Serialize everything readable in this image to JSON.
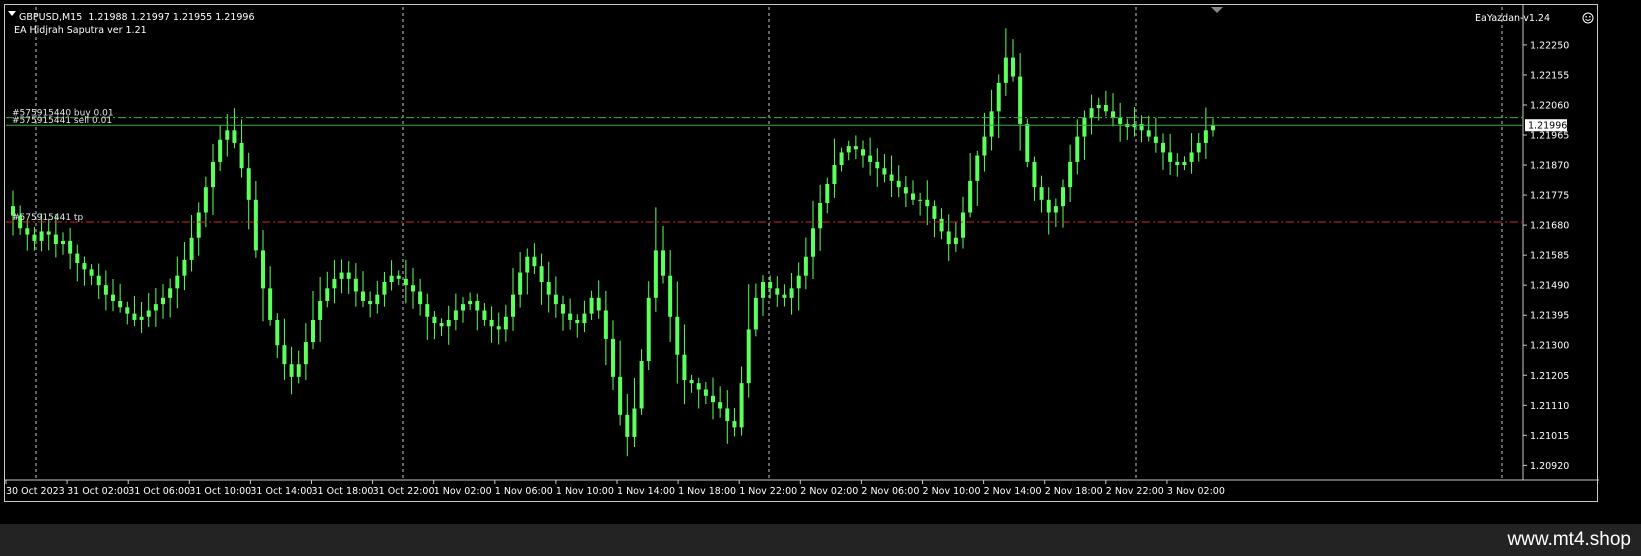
{
  "header": {
    "symbol_label": "GBPUSD,M15",
    "ohlc_text": "1.21988 1.21997 1.21955 1.21996",
    "ea_name": "EA Hidjrah Saputra ver 1.21",
    "ea_right_label": "EaYazdan-v1.24"
  },
  "footer": {
    "watermark": "www.mt4.shop"
  },
  "colors": {
    "background": "#000000",
    "candle": "#5cff5c",
    "grid": "#c8c8c8",
    "price_line": "#3fae3f",
    "tp_line": "#d22020",
    "text": "#ffffff",
    "footer_bg": "#232323"
  },
  "icons": {
    "dropdown": "triangle-down-icon",
    "smiley": "smiley-icon"
  },
  "chart_data": {
    "type": "candlestick",
    "symbol": "GBPUSD",
    "timeframe": "M15",
    "ylim": [
      1.2088,
      1.2237
    ],
    "y_ticks": [
      "1.22250",
      "1.22155",
      "1.22060",
      "1.21965",
      "1.21870",
      "1.21775",
      "1.21680",
      "1.21585",
      "1.21490",
      "1.21395",
      "1.21300",
      "1.21205",
      "1.21110",
      "1.21015",
      "1.20920"
    ],
    "current_price": "1.21996",
    "x_ticks": [
      "30 Oct 2023",
      "31 Oct 02:00",
      "31 Oct 06:00",
      "31 Oct 10:00",
      "31 Oct 14:00",
      "31 Oct 18:00",
      "31 Oct 22:00",
      "1 Nov 02:00",
      "1 Nov 06:00",
      "1 Nov 10:00",
      "1 Nov 14:00",
      "1 Nov 18:00",
      "1 Nov 22:00",
      "2 Nov 02:00",
      "2 Nov 06:00",
      "2 Nov 10:00",
      "2 Nov 14:00",
      "2 Nov 18:00",
      "2 Nov 22:00",
      "3 Nov 02:00"
    ],
    "order_lines": [
      {
        "label": "#575915440 buy 0.01",
        "price": 1.2202,
        "style": "dash-dot",
        "color": "#3fae3f"
      },
      {
        "label": "#575915441 sell 0.01",
        "price": 1.21996,
        "style": "solid",
        "color": "#3fae3f"
      },
      {
        "label": "#575915441 tp",
        "price": 1.2169,
        "style": "dash-dot",
        "color": "#d22020"
      }
    ],
    "closes": [
      1.2171,
      1.2167,
      1.2165,
      1.2163,
      1.2166,
      1.2165,
      1.2162,
      1.2163,
      1.2159,
      1.2156,
      1.2154,
      1.2152,
      1.2149,
      1.2146,
      1.2144,
      1.2142,
      1.214,
      1.2138,
      1.2139,
      1.2141,
      1.2143,
      1.2145,
      1.2148,
      1.2152,
      1.2157,
      1.2164,
      1.2172,
      1.218,
      1.2188,
      1.2195,
      1.2198,
      1.2194,
      1.2186,
      1.2176,
      1.216,
      1.2148,
      1.2138,
      1.213,
      1.2124,
      1.212,
      1.2124,
      1.2131,
      1.2138,
      1.2144,
      1.2148,
      1.2151,
      1.2153,
      1.2151,
      1.2147,
      1.2144,
      1.2143,
      1.2146,
      1.215,
      1.2152,
      1.2151,
      1.2149,
      1.2147,
      1.2143,
      1.2139,
      1.2137,
      1.2136,
      1.2138,
      1.2141,
      1.2143,
      1.2144,
      1.2141,
      1.2138,
      1.2136,
      1.2135,
      1.2139,
      1.2146,
      1.2153,
      1.2158,
      1.2155,
      1.215,
      1.2146,
      1.2143,
      1.214,
      1.2138,
      1.2137,
      1.214,
      1.2145,
      1.2141,
      1.2132,
      1.212,
      1.2108,
      1.2101,
      1.211,
      1.2125,
      1.2145,
      1.216,
      1.2152,
      1.2139,
      1.2127,
      1.2119,
      1.2118,
      1.2116,
      1.2114,
      1.2112,
      1.211,
      1.2106,
      1.2104,
      1.2118,
      1.2135,
      1.2145,
      1.215,
      1.2148,
      1.2146,
      1.2145,
      1.2148,
      1.2152,
      1.2158,
      1.2167,
      1.2175,
      1.2181,
      1.2187,
      1.2191,
      1.2193,
      1.2192,
      1.219,
      1.2188,
      1.2186,
      1.2184,
      1.2182,
      1.218,
      1.2178,
      1.2176,
      1.2176,
      1.2174,
      1.217,
      1.2166,
      1.2162,
      1.2164,
      1.2172,
      1.2182,
      1.219,
      1.2196,
      1.2204,
      1.2213,
      1.2221,
      1.2215,
      1.22,
      1.2188,
      1.218,
      1.2176,
      1.2172,
      1.2174,
      1.218,
      1.2188,
      1.2196,
      1.2202,
      1.2205,
      1.2206,
      1.2204,
      1.2202,
      1.22,
      1.2199,
      1.22,
      1.2198,
      1.2196,
      1.2194,
      1.2191,
      1.2188,
      1.2187,
      1.2188,
      1.2191,
      1.2194,
      1.2198,
      1.21996
    ]
  }
}
